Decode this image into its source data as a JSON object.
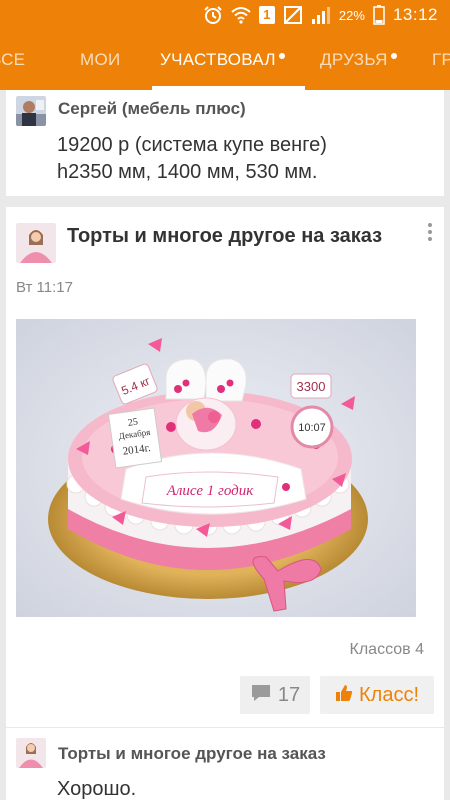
{
  "statusbar": {
    "sim": "1",
    "battery": "22%",
    "time": "13:12",
    "icons": [
      "alarm-icon",
      "wifi-icon",
      "sim-icon",
      "no-sim-icon",
      "signal-icon",
      "battery-icon"
    ]
  },
  "tabs": [
    {
      "label": "ВСЕ",
      "active": false,
      "dot": false
    },
    {
      "label": "МОИ",
      "active": false,
      "dot": false
    },
    {
      "label": "УЧАСТВОВАЛ",
      "active": true,
      "dot": true
    },
    {
      "label": "ДРУЗЬЯ",
      "active": false,
      "dot": true
    },
    {
      "label": "ГР",
      "active": false,
      "dot": false
    }
  ],
  "card1": {
    "author": "Сергей (мебель плюс)",
    "line1": "19200 р (система купе венге)",
    "line2": "h2350 мм, 1400 мм, 530 мм."
  },
  "card2": {
    "title": "Торты и многое другое на заказ",
    "time": "Вт 11:17",
    "klass_count": "Классов 4",
    "comments": "17",
    "like_label": "Класс!",
    "photo": {
      "tag_price": "3300",
      "tag_weight": "5.4 кг",
      "calendar_day": "25",
      "calendar_month": "Декабря",
      "calendar_year": "2014г.",
      "clock_time": "10:07",
      "banner": "Алисе 1 годик"
    }
  },
  "card3": {
    "author": "Торты и многое другое на заказ",
    "text": "Хорошо."
  },
  "colors": {
    "accent": "#ee8208",
    "background": "#e9e9e9"
  }
}
